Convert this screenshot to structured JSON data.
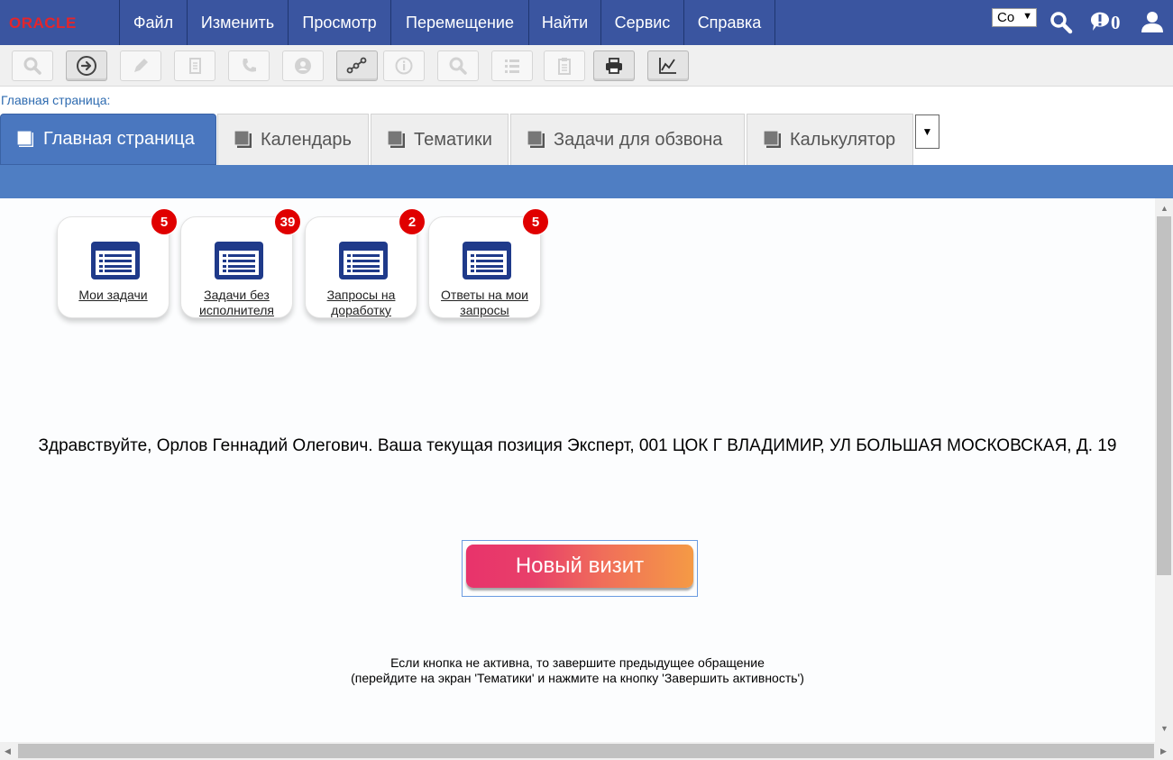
{
  "brand": {
    "logo_text": "ORACLE"
  },
  "menu": {
    "items": [
      "Файл",
      "Изменить",
      "Просмотр",
      "Перемещение",
      "Найти",
      "Сервис",
      "Справка"
    ],
    "language_select": "Co",
    "notifications_count": "0"
  },
  "toolbar": {
    "buttons": [
      {
        "icon": "magnifier-icon",
        "enabled": false
      },
      {
        "icon": "arrow-right-circle-icon",
        "enabled": true
      },
      {
        "icon": "pencil-icon",
        "enabled": false
      },
      {
        "icon": "document-icon",
        "enabled": false
      },
      {
        "icon": "phone-icon",
        "enabled": false
      },
      {
        "icon": "contact-icon",
        "enabled": false
      },
      {
        "icon": "workflow-icon",
        "enabled": true
      },
      {
        "icon": "info-icon",
        "enabled": false
      },
      {
        "icon": "search-icon",
        "enabled": false
      },
      {
        "icon": "list-icon",
        "enabled": false
      },
      {
        "icon": "clipboard-icon",
        "enabled": false
      },
      {
        "icon": "printer-icon",
        "enabled": true
      },
      {
        "icon": "chart-icon",
        "enabled": true
      }
    ]
  },
  "breadcrumb": "Главная страница:",
  "tabs": [
    {
      "label": "Главная страница",
      "active": true
    },
    {
      "label": "Календарь",
      "active": false
    },
    {
      "label": "Тематики",
      "active": false
    },
    {
      "label": "Задачи для обзвона",
      "active": false
    },
    {
      "label": "Калькулятор",
      "active": false
    }
  ],
  "cards": [
    {
      "label": "Мои задачи",
      "count": "5"
    },
    {
      "label": "Задачи без исполнителя",
      "count": "39"
    },
    {
      "label": "Запросы на доработку",
      "count": "2"
    },
    {
      "label": "Ответы на мои запросы",
      "count": "5"
    }
  ],
  "greeting": "Здравствуйте, Орлов Геннадий Олегович. Ваша текущая позиция Эксперт, 001 ЦОК Г ВЛАДИМИР, УЛ БОЛЬШАЯ МОСКОВСКАЯ, Д. 19",
  "visit_button": "Новый визит",
  "hint": {
    "line1": "Если кнопка не активна, то завершите предыдущее обращение",
    "line2": "(перейдите на экран 'Тематики' и нажмите на кнопку 'Завершить активность')"
  },
  "colors": {
    "menubar": "#3a55a0",
    "tab_active": "#4a77bf",
    "band": "#4f7ec3",
    "badge": "#e00000",
    "logo_red": "#e4252b"
  }
}
